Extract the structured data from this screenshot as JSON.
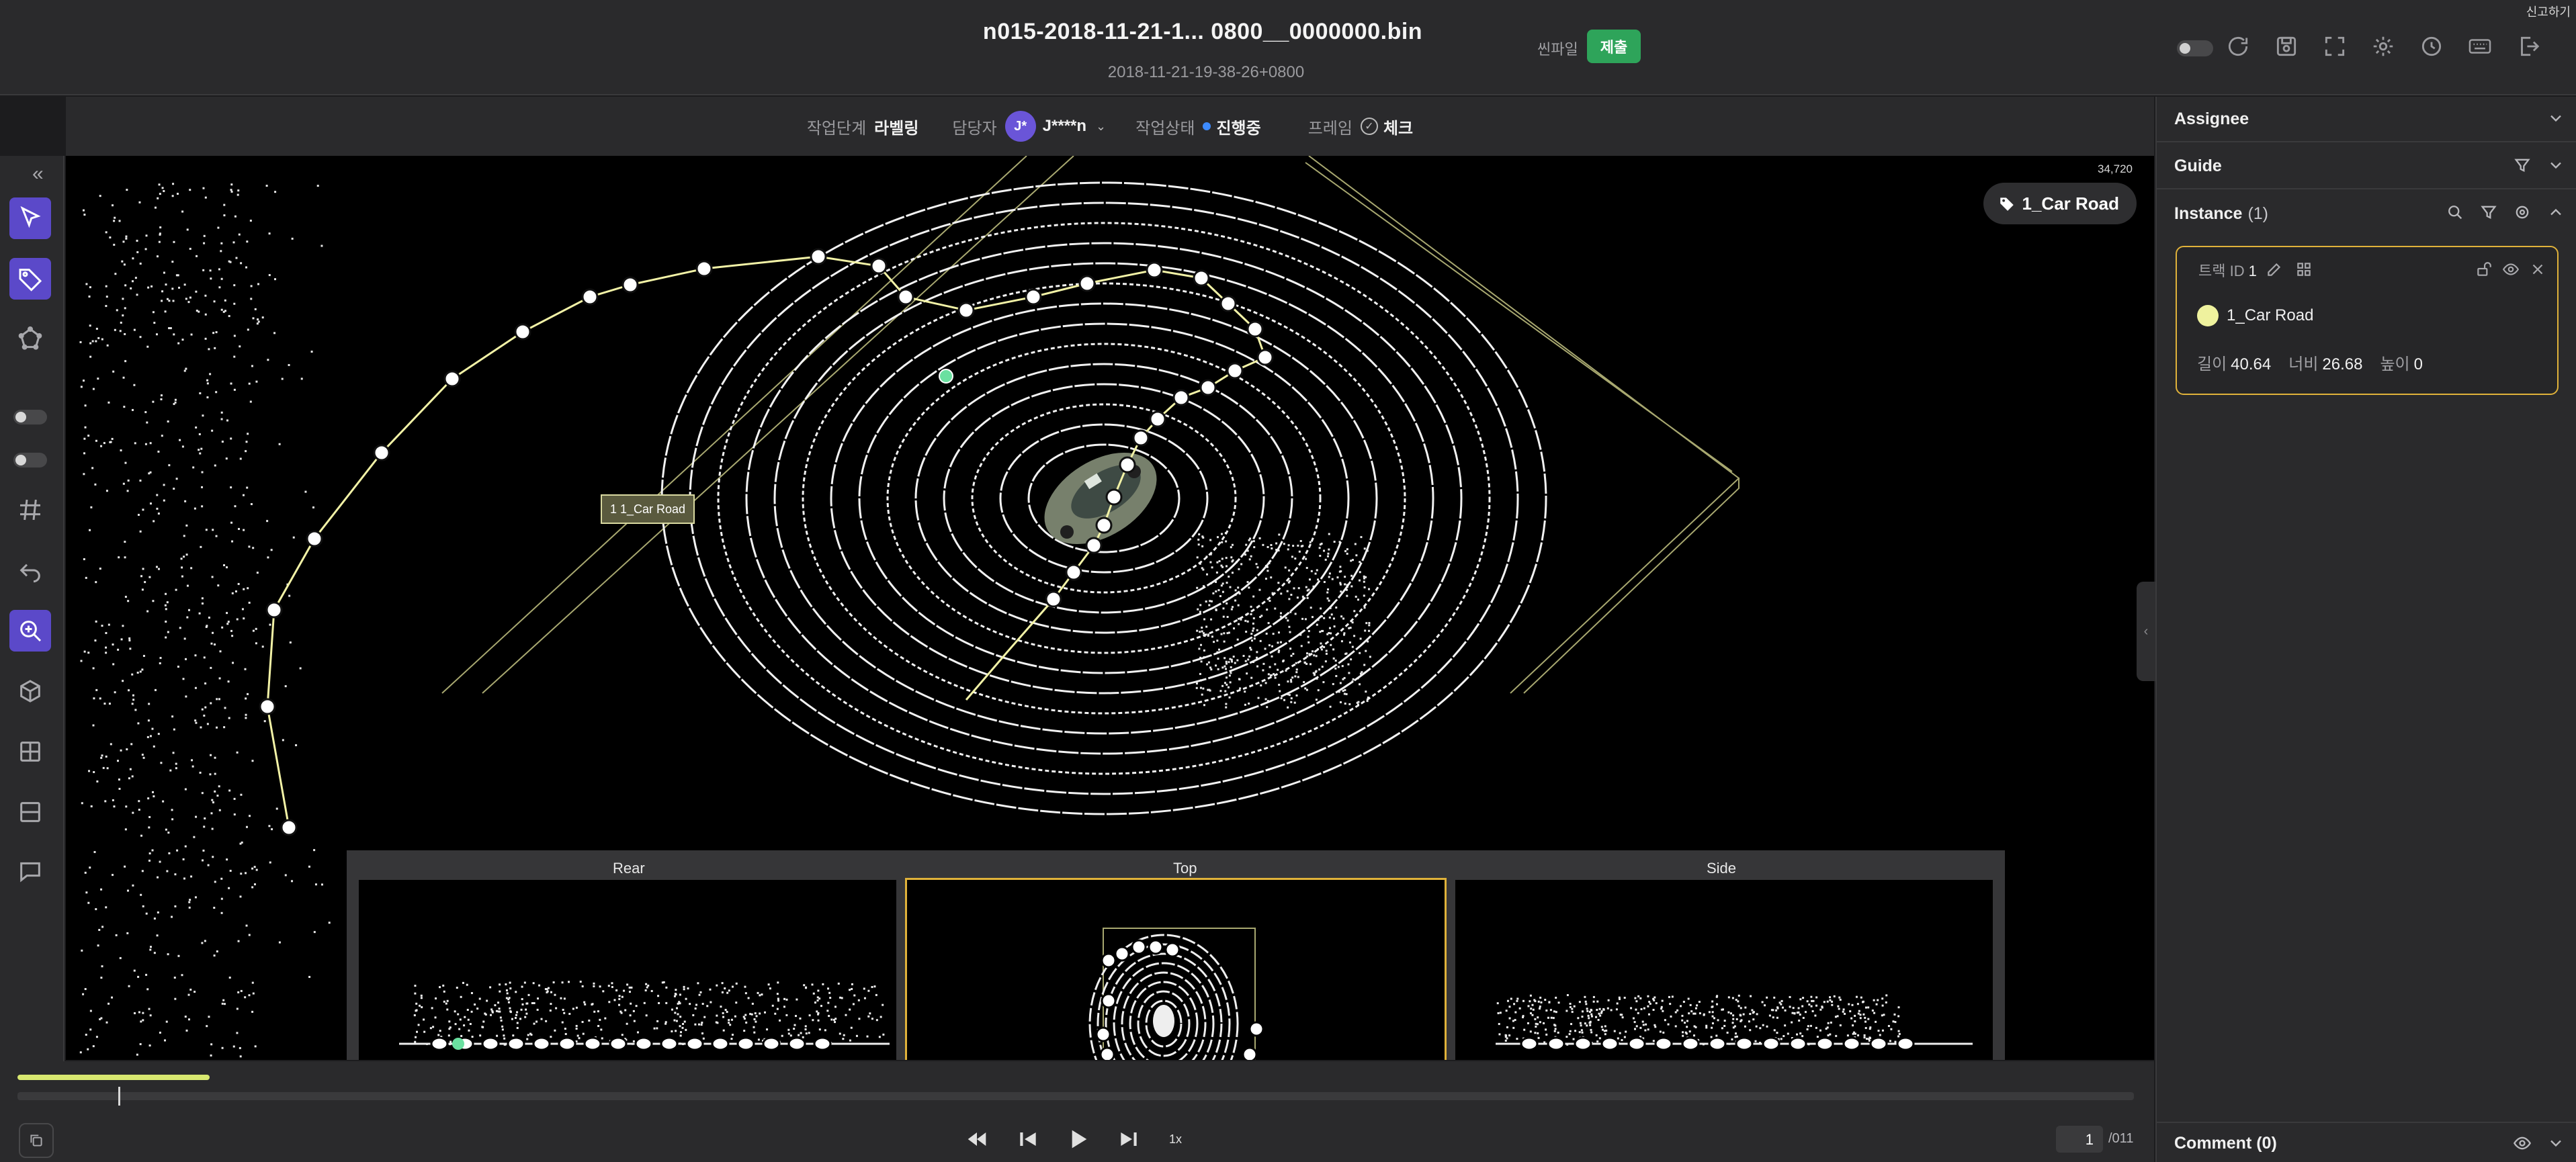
{
  "header": {
    "file_name": "n015-2018-11-21-1...  0800__0000000.bin",
    "timestamp": "2018-11-21-19-38-26+0800",
    "scene_label": "씬파일",
    "submit_label": "제출",
    "report_label": "신고하기"
  },
  "status": {
    "stage_label": "작업단계",
    "stage_value": "라벨링",
    "assignee_label": "담당자",
    "assignee_initial": "J*",
    "assignee_name": "J****n",
    "work_status_label": "작업상태",
    "work_status_value": "진행중",
    "frame_label": "프레임",
    "frame_value": "체크"
  },
  "viewport": {
    "point_count": "34,720",
    "class_pill": "1_Car Road",
    "instance_label": "1  1_Car Road"
  },
  "views": {
    "rear": "Rear",
    "top": "Top",
    "side": "Side"
  },
  "timeline": {
    "speed": "1x",
    "frame_current": "1",
    "frame_total": "/011"
  },
  "panel": {
    "assignee": "Assignee",
    "guide": "Guide",
    "instance": "Instance",
    "instance_count": "(1)",
    "track_label": "트랙 ID",
    "track_id": "1",
    "class_name": "1_Car Road",
    "class_color": "#eff29e",
    "length_label": "길이",
    "length_value": "40.64",
    "width_label": "너비",
    "width_value": "26.68",
    "height_label": "높이",
    "height_value": "0",
    "comment": "Comment (0)"
  },
  "colors": {
    "accent": "#5b49c9",
    "submit": "#2ea45a",
    "selection": "#e0b23a",
    "polyline": "#f2f2a6"
  }
}
